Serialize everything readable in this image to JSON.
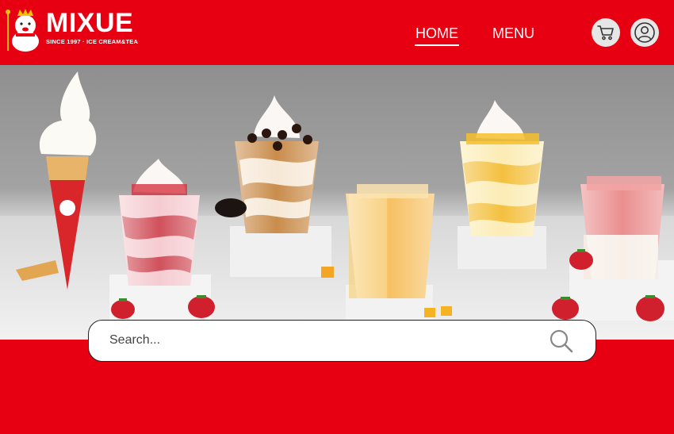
{
  "brand": {
    "name": "MIXUE",
    "tagline": "SINCE 1997 · ICE CREAM&TEA",
    "mascot_icon": "snowman-king-icon"
  },
  "nav": {
    "items": [
      {
        "label": "HOME",
        "active": true
      },
      {
        "label": "MENU",
        "active": false
      }
    ]
  },
  "header_actions": {
    "cart_icon": "cart-icon",
    "account_icon": "user-icon"
  },
  "hero": {
    "image": "ice-cream-sundaes-and-drinks-lineup"
  },
  "search": {
    "placeholder": "Search...",
    "value": "",
    "icon": "search-icon"
  },
  "colors": {
    "brand_red": "#e60012",
    "white": "#ffffff",
    "icon_button_bg": "#e6e6e6"
  }
}
